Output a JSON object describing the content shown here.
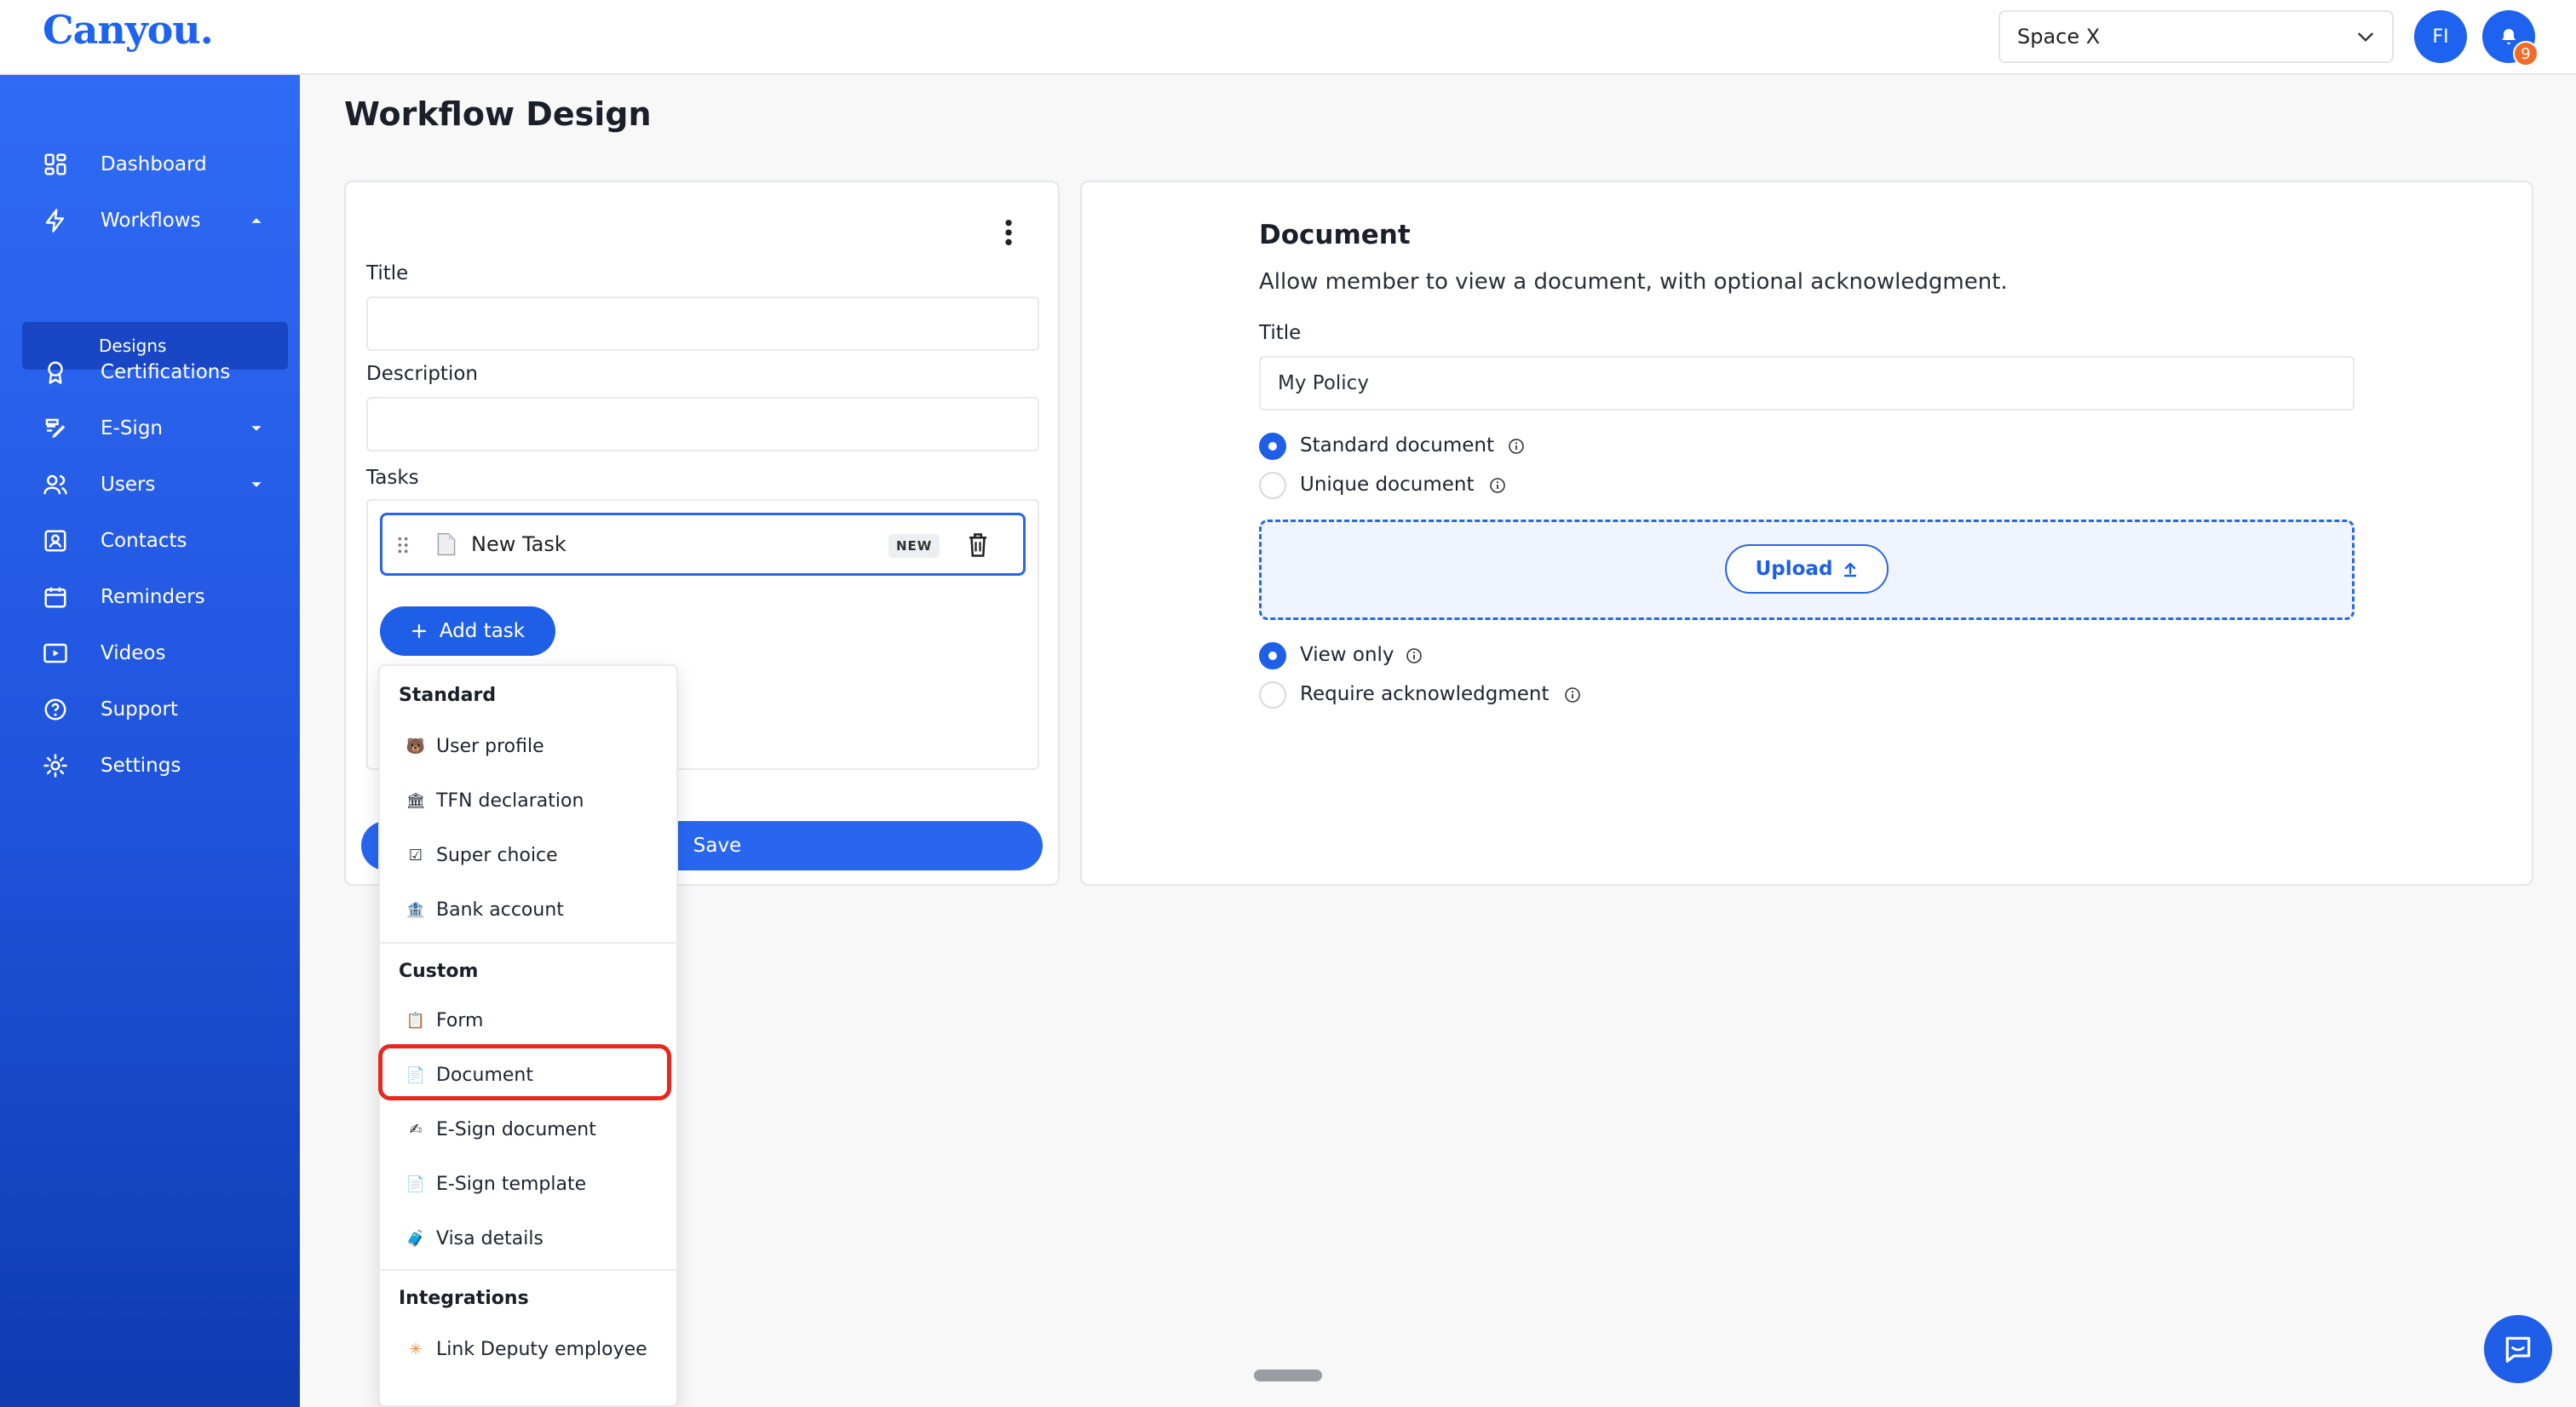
{
  "header": {
    "logo": "Canyou.",
    "space_selector": "Space X",
    "avatar_initials": "FI",
    "notification_count": "9"
  },
  "sidebar": {
    "items": [
      {
        "label": "Dashboard",
        "icon": "dashboard-icon"
      },
      {
        "label": "Workflows",
        "icon": "lightning-icon",
        "expanded": true
      },
      {
        "label": "Certifications",
        "icon": "award-icon"
      },
      {
        "label": "E-Sign",
        "icon": "signature-icon",
        "expandable": true
      },
      {
        "label": "Users",
        "icon": "users-icon",
        "expandable": true
      },
      {
        "label": "Contacts",
        "icon": "contacts-icon"
      },
      {
        "label": "Reminders",
        "icon": "calendar-icon"
      },
      {
        "label": "Videos",
        "icon": "video-icon"
      },
      {
        "label": "Support",
        "icon": "help-icon"
      },
      {
        "label": "Settings",
        "icon": "gear-icon"
      }
    ],
    "sub_item": "Designs"
  },
  "page": {
    "title": "Workflow Design"
  },
  "workflow_form": {
    "title_label": "Title",
    "title_value": "",
    "description_label": "Description",
    "description_value": "",
    "tasks_label": "Tasks",
    "task": {
      "name": "New Task",
      "badge": "NEW"
    },
    "add_task_label": "Add task",
    "save_label": "Save"
  },
  "task_menu": {
    "sections": [
      {
        "heading": "Standard",
        "items": [
          {
            "label": "User profile",
            "emoji": "🐻"
          },
          {
            "label": "TFN declaration",
            "emoji": "🏛"
          },
          {
            "label": "Super choice",
            "emoji": "☑"
          },
          {
            "label": "Bank account",
            "emoji": "🏦"
          }
        ]
      },
      {
        "heading": "Custom",
        "items": [
          {
            "label": "Form",
            "emoji": "📋"
          },
          {
            "label": "Document",
            "emoji": "📄",
            "highlighted": true
          },
          {
            "label": "E-Sign document",
            "emoji": "✍"
          },
          {
            "label": "E-Sign template",
            "emoji": "📄"
          },
          {
            "label": "Visa details",
            "emoji": "🧳"
          }
        ]
      },
      {
        "heading": "Integrations",
        "items": [
          {
            "label": "Link Deputy employee",
            "emoji": "✳"
          }
        ]
      }
    ]
  },
  "document_panel": {
    "heading": "Document",
    "subtitle": "Allow member to view a document, with optional acknowledgment.",
    "title_label": "Title",
    "title_value": "My Policy",
    "doc_type_options": [
      {
        "label": "Standard document",
        "selected": true
      },
      {
        "label": "Unique document",
        "selected": false
      }
    ],
    "upload_label": "Upload",
    "ack_options": [
      {
        "label": "View only",
        "selected": true
      },
      {
        "label": "Require acknowledgment",
        "selected": false
      }
    ]
  },
  "colors": {
    "primary": "#1f5fe8",
    "highlight_outline": "#e8281e",
    "badge": "#f26b2a"
  }
}
